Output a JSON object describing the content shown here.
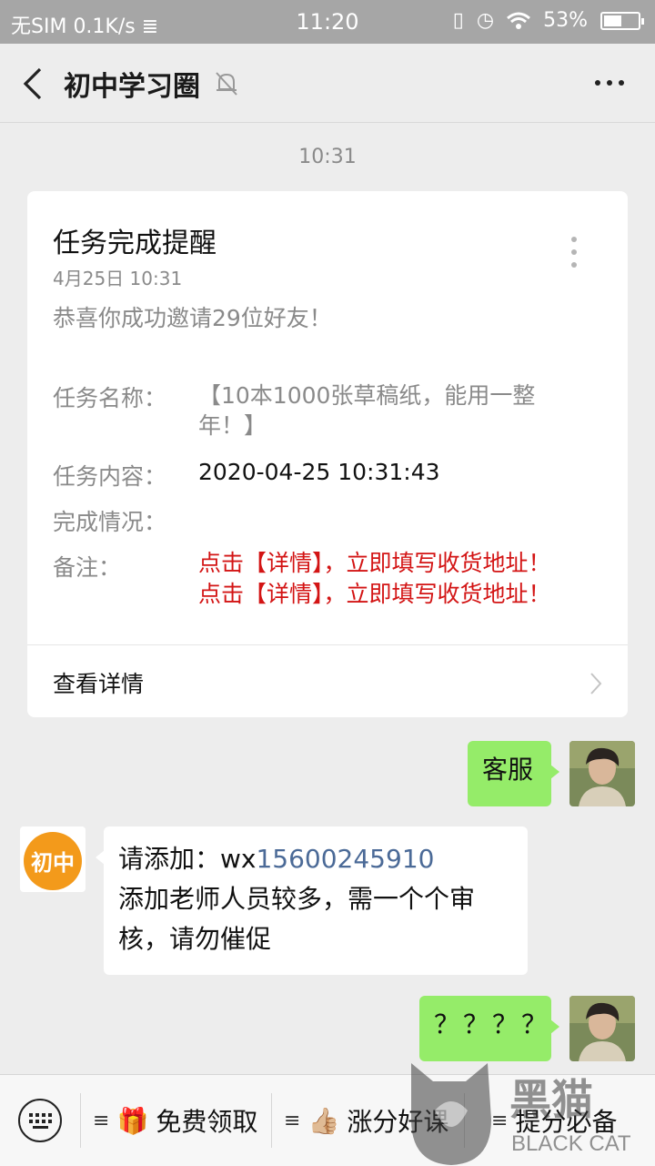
{
  "status_bar": {
    "carrier": "无SIM",
    "speed": "0.1K/s",
    "time": "11:20",
    "battery": "53%",
    "battery_level": 0.53
  },
  "nav": {
    "title": "初中学习圈"
  },
  "chat": {
    "timestamp": "10:31",
    "card": {
      "title": "任务完成提醒",
      "date": "4月25日  10:31",
      "desc": "恭喜你成功邀请29位好友！",
      "rows": [
        {
          "label": "任务名称：",
          "value": "【10本1000张草稿纸，能用一整年！】"
        },
        {
          "label": "任务内容：",
          "value": "2020-04-25 10:31:43"
        },
        {
          "label": "完成情况：",
          "value": ""
        },
        {
          "label": "备注：",
          "value_lines": [
            "点击【详情】，立即填写收货地址！",
            "点击【详情】，立即填写收货地址！"
          ]
        }
      ],
      "detail_link": "查看详情"
    },
    "messages": [
      {
        "from": "me",
        "text": "客服"
      },
      {
        "from": "them",
        "avatar_text": "初中",
        "line1_prefix": "请添加：wx",
        "line1_link": "15600245910",
        "line2": "添加老师人员较多，需一个个审核，请勿催促"
      },
      {
        "from": "me",
        "text": "？？？？"
      }
    ]
  },
  "bottom_menu": [
    {
      "icon": "gift-icon",
      "emoji": "🎁",
      "label": "免费领取"
    },
    {
      "icon": "thumbs-up-icon",
      "emoji": "👍🏼",
      "label": "涨分好课"
    },
    {
      "label": "提分必备"
    }
  ],
  "watermark": {
    "cn": "黑猫",
    "en": "BLACK CAT"
  },
  "colors": {
    "bubble_green": "#95ec69",
    "link": "#4b6a97",
    "alert_red": "#d31414",
    "avatar_orange": "#f39a1b"
  }
}
